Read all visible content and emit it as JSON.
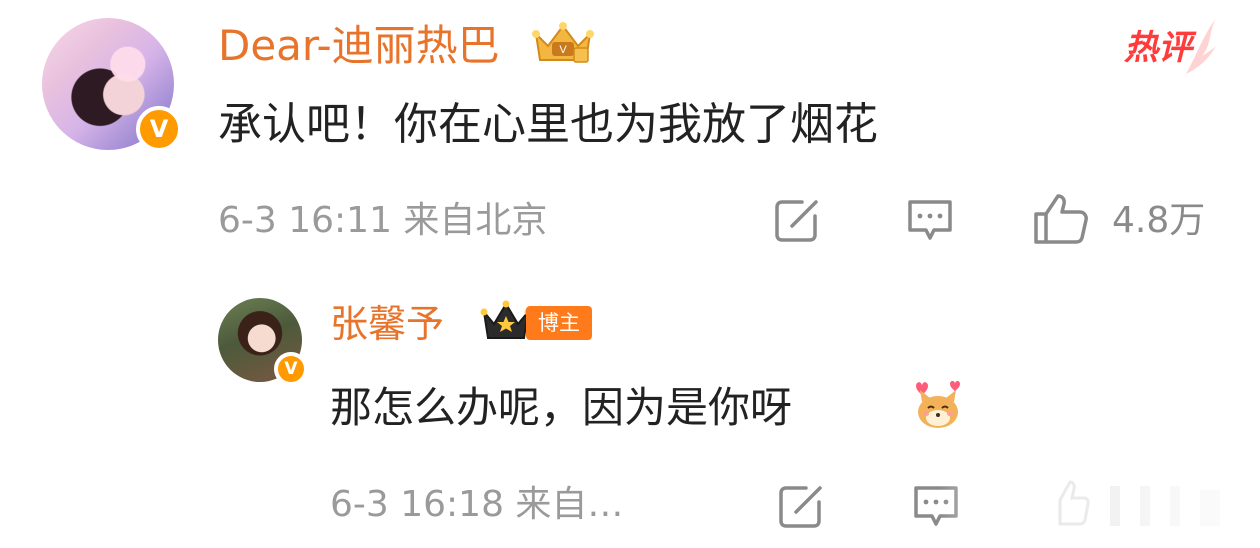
{
  "main_comment": {
    "username": "Dear-迪丽热巴",
    "text": "承认吧！你在心里也为我放了烟花",
    "meta": "6-3 16:11  来自北京",
    "like_count": "4.8万",
    "hot_badge": "热评",
    "verified_icon": "v-icon",
    "crown_icon": "gold-crown-vip-icon"
  },
  "reply": {
    "username": "张馨予",
    "blogger_tag": "博主",
    "text": "那怎么办呢，因为是你呀",
    "emoji": "shiba-dog-heart-emoji",
    "meta": "6-3 16:18  来自…",
    "verified_icon": "v-icon",
    "crown_icon": "black-crown-vip-icon"
  },
  "colors": {
    "username": "#e8732a",
    "verified_badge": "#ff9a00",
    "hot_badge": "#ff3b3b",
    "meta_text": "#9a9a9a",
    "body_text": "#222222"
  }
}
